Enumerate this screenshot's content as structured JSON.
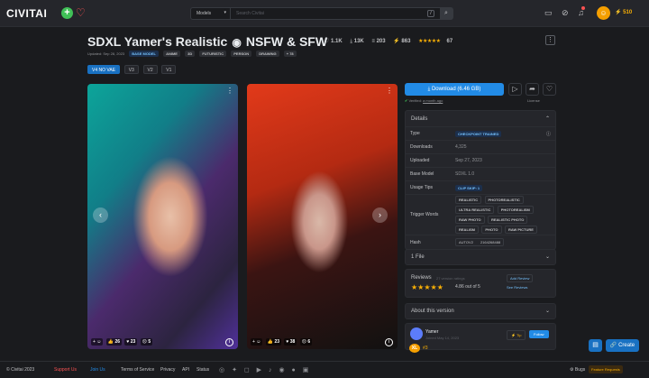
{
  "header": {
    "logo": "CIVITAI",
    "search_scope": "Models",
    "search_placeholder": "Search Civitai",
    "search_shortcut": "/",
    "buzz": "510"
  },
  "model": {
    "title": "SDXL Yamer's Realistic",
    "title2": "NSFW & SFW",
    "likes": "1.1K",
    "downloads": "13K",
    "collections": "203",
    "buzz": "863",
    "stars": "★★★★★",
    "rating_count": "67",
    "updated": "Updated: Sep 28, 2023",
    "tags": [
      "BASE MODEL",
      "ANIME",
      "3D",
      "FUTURISTIC",
      "PERSON",
      "DRAWING",
      "+ 78"
    ]
  },
  "versions": [
    "V4 NO VAE",
    "V3",
    "V2",
    "V1"
  ],
  "cards": [
    {
      "likes": "26",
      "hearts": "23",
      "cry": "5"
    },
    {
      "likes": "23",
      "hearts": "38",
      "cry": "6"
    }
  ],
  "sidebar": {
    "download_label": "Download (6.46 GB)",
    "verified": "Verified:",
    "verified_when": "a month ago",
    "license": "License",
    "details_title": "Details",
    "details": {
      "type_k": "Type",
      "type_v": "CHECKPOINT TRAINED",
      "downloads_k": "Downloads",
      "downloads_v": "4,325",
      "uploaded_k": "Uploaded",
      "uploaded_v": "Sep 27, 2023",
      "base_k": "Base Model",
      "base_v": "SDXL 1.0",
      "tips_k": "Usage Tips",
      "tips_v": "CLIP SKIP: 1",
      "trigger_k": "Trigger Words",
      "triggers": [
        "REALISTIC",
        "PHOTOREALISTIC",
        "ULTRA REALISTIC",
        "PHOTOREALISM",
        "RAW PHOTO",
        "REALISTIC PHOTO",
        "REALISM",
        "PHOTO",
        "RAW PICTURE"
      ],
      "hash_k": "Hash",
      "hash_algo": "AUTOV2",
      "hash_v": "2164268488"
    },
    "files": "1 File",
    "reviews_title": "Reviews",
    "reviews_count": "27 version ratings",
    "reviews_stars": "★★★★★",
    "reviews_score": "4.86 out of 5",
    "add_review": "Add Review",
    "see_reviews": "See Reviews",
    "about": "About this version",
    "creator": "Yamer",
    "joined": "Joined May 14, 2023",
    "tip": "Tip",
    "follow": "Follow",
    "xl": "XL",
    "xl_num": "#3"
  },
  "fab": {
    "create": "Create"
  },
  "footer": {
    "copyright": "© Civitai 2023",
    "links": [
      "Support Us",
      "Join Us",
      "Terms of Service",
      "Privacy",
      "API",
      "Status"
    ],
    "bugs": "Bugs",
    "feature": "Feature Requests"
  }
}
